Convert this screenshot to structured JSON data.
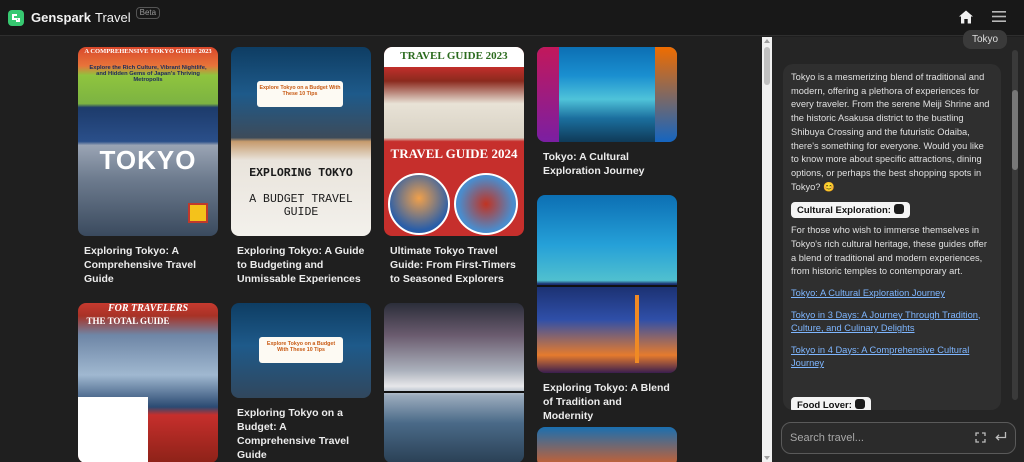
{
  "app": {
    "brand": "Genspark",
    "product": "Travel",
    "badge": "Beta",
    "icons": {
      "home": "home-icon",
      "menu": "hamburger-menu-icon"
    }
  },
  "cards": [
    {
      "title": "Exploring Tokyo: A Comprehensive Travel Guide",
      "overlay": {
        "top": "A COMPREHENSIVE TOKYO GUIDE 2023",
        "mid": "Explore the Rich Culture, Vibrant Nightlife, and Hidden Gems of Japan's Thriving Metropolis",
        "big": "TOKYO"
      }
    },
    {
      "title": "Exploring Tokyo: A Guide to Budgeting and Unmissable Experiences",
      "overlay": {
        "chip": "Explore Tokyo on a Budget With These 10 Tips",
        "big1": "EXPLORING TOKYO",
        "big2": "A BUDGET TRAVEL GUIDE"
      }
    },
    {
      "title": "Ultimate Tokyo Travel Guide: From First-Timers to Seasoned Explorers",
      "overlay": {
        "top": "TRAVEL GUIDE 2023",
        "big": "TRAVEL GUIDE 2024"
      }
    },
    {
      "title": "Tokyo: A Cultural Exploration Journey"
    },
    {
      "title": "Exploring Tokyo: A Blend of Tradition and Modernity"
    },
    {
      "title": "",
      "overlay": {
        "top": "FOR TRAVELERS",
        "mid": "THE TOTAL GUIDE"
      }
    },
    {
      "title": "Exploring Tokyo on a Budget: A Comprehensive Travel Guide",
      "overlay": {
        "chip": "Explore Tokyo on a Budget With These 10 Tips"
      }
    },
    {
      "title": ""
    },
    {
      "title": ""
    }
  ],
  "chat": {
    "user_message": "Tokyo",
    "intro": "Tokyo is a mesmerizing blend of traditional and modern, offering a plethora of experiences for every traveler. From the serene Meiji Shrine and the historic Asakusa district to the bustling Shibuya Crossing and the futuristic Odaiba, there's something for everyone. Would you like to know more about specific attractions, dining options, or perhaps the best shopping spots in Tokyo? 😊",
    "sections": [
      {
        "tag": "Cultural Exploration:",
        "text": "For those who wish to immerse themselves in Tokyo's rich cultural heritage, these guides offer a blend of traditional and modern experiences, from historic temples to contemporary art.",
        "links": [
          "Tokyo: A Cultural Exploration Journey",
          "Tokyo in 3 Days: A Journey Through Tradition, Culture, and Culinary Delights",
          "Tokyo in 4 Days: A Comprehensive Cultural Journey"
        ]
      },
      {
        "tag": "Food Lover:"
      }
    ],
    "search_placeholder": "Search travel...",
    "icons": {
      "expand": "expand-icon",
      "submit": "enter-icon"
    }
  },
  "colors": {
    "accent": "#37c871",
    "link": "#7eb6ff",
    "background": "#1f1f1f"
  }
}
